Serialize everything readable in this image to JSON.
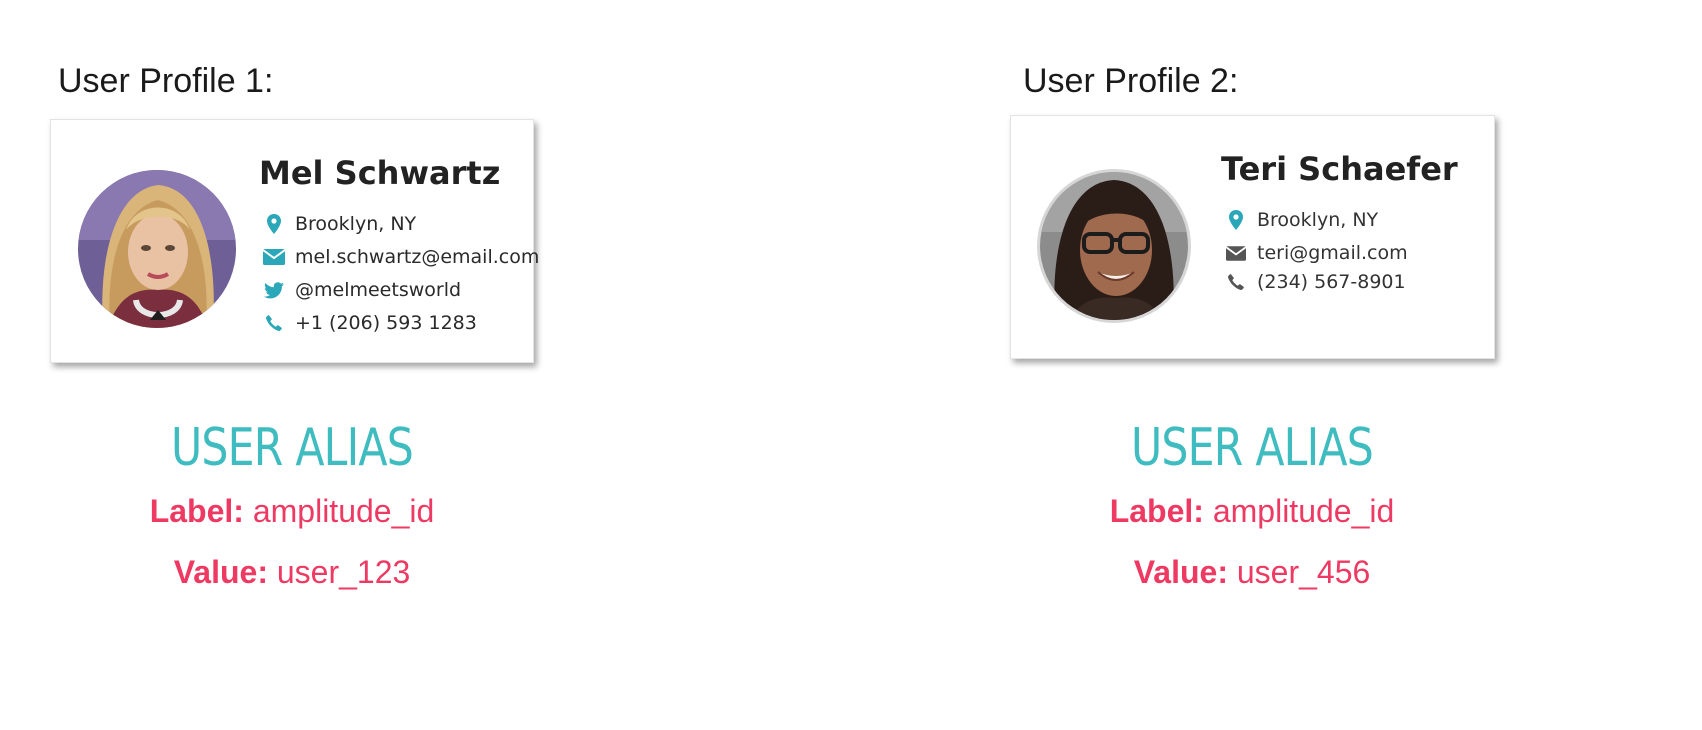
{
  "colors": {
    "alias_title": "#3fbcbf",
    "alias_text": "#ee3a63",
    "icon": "#2aa7b8",
    "icon_gray": "#555555"
  },
  "profiles": [
    {
      "heading": "User Profile 1:",
      "name": "Mel Schwartz",
      "avatar_icon": "avatar-photo",
      "info": [
        {
          "icon": "location-pin-icon",
          "text": "Brooklyn, NY"
        },
        {
          "icon": "email-icon",
          "text": "mel.schwartz@email.com"
        },
        {
          "icon": "twitter-icon",
          "text": "@melmeetsworld"
        },
        {
          "icon": "phone-icon",
          "text": "+1 (206) 593 1283"
        }
      ],
      "alias": {
        "title": "USER ALIAS",
        "label_key": "Label:",
        "label_value": "amplitude_id",
        "value_key": "Value:",
        "value_value": "user_123"
      }
    },
    {
      "heading": "User Profile 2:",
      "name": "Teri Schaefer",
      "avatar_icon": "avatar-photo",
      "info": [
        {
          "icon": "location-pin-icon",
          "text": "Brooklyn, NY"
        },
        {
          "icon": "email-icon",
          "text": "teri@gmail.com"
        },
        {
          "icon": "phone-icon",
          "text": "(234) 567-8901"
        }
      ],
      "alias": {
        "title": "USER ALIAS",
        "label_key": "Label:",
        "label_value": "amplitude_id",
        "value_key": "Value:",
        "value_value": "user_456"
      }
    }
  ]
}
